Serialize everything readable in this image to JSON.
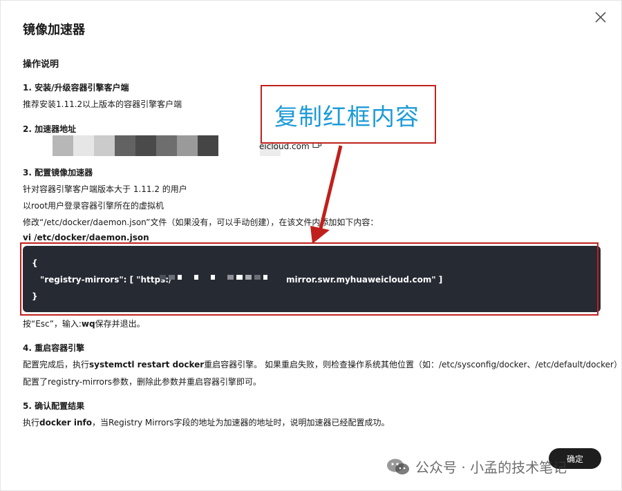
{
  "dialog": {
    "title": "镜像加速器",
    "close_label": "×"
  },
  "instructions": {
    "heading": "操作说明",
    "step1": {
      "title": "1. 安装/升级容器引擎客户端",
      "text": "推荐安装1.11.2以上版本的容器引擎客户端"
    },
    "step2": {
      "title": "2. 加速器地址",
      "address_visible_tail": "eicloud.com"
    },
    "step3": {
      "title": "3. 配置镜像加速器",
      "line1": "针对容器引擎客户端版本大于 1.11.2 的用户",
      "line2": "以root用户登录容器引擎所在的虚拟机",
      "line3": "修改“/etc/docker/daemon.json”文件（如果没有，可以手动创建），在该文件内添加如下内容：",
      "command": "vi /etc/docker/daemon.json",
      "code_open": "{",
      "code_prefix": "\"registry-mirrors\": [ \"https:/",
      "code_suffix": "mirror.swr.myhuaweicloud.com\" ]",
      "code_close": "}",
      "save_hint_prefix": "按“Esc”，输入:",
      "save_hint_cmd": "wq",
      "save_hint_suffix": "保存并退出。"
    },
    "step4": {
      "title": "4. 重启容器引擎",
      "line1_prefix": "配置完成后，执行",
      "line1_cmd": "systemctl restart docker",
      "line1_suffix": "重启容器引擎。 如果重启失败，则检查操作系统其他位置（如：/etc/sysconfig/docker、/etc/default/docker）是否",
      "line2": "配置了registry-mirrors参数，删除此参数并重启容器引擎即可。"
    },
    "step5": {
      "title": "5. 确认配置结果",
      "line_prefix": "执行",
      "line_cmd": "docker info",
      "line_suffix": "，当Registry Mirrors字段的地址为加速器的地址时，说明加速器已经配置成功。"
    }
  },
  "annotation": {
    "text": "复制红框内容",
    "color": "#c0201c",
    "text_color": "#1d9bd7"
  },
  "footer": {
    "ok_label": "确定"
  },
  "watermark": {
    "text": "公众号 · 小孟的技术笔记"
  }
}
